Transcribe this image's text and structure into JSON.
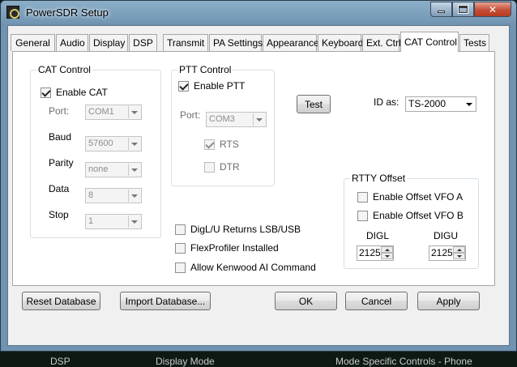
{
  "window": {
    "title": "PowerSDR Setup"
  },
  "caption": {
    "minimize": "",
    "maximize": "",
    "close": "✕"
  },
  "tabs": [
    {
      "label": "General"
    },
    {
      "label": "Audio"
    },
    {
      "label": "Display"
    },
    {
      "label": "DSP"
    },
    {
      "label": "Transmit"
    },
    {
      "label": "PA Settings"
    },
    {
      "label": "Appearance"
    },
    {
      "label": "Keyboard"
    },
    {
      "label": "Ext. Ctrl"
    },
    {
      "label": "CAT Control"
    },
    {
      "label": "Tests"
    }
  ],
  "active_tab": "CAT Control",
  "cat_control": {
    "title": "CAT Control",
    "enable": {
      "label": "Enable CAT",
      "checked": true
    },
    "port": {
      "label": "Port:",
      "value": "COM1"
    },
    "baud": {
      "label": "Baud",
      "value": "57600"
    },
    "parity": {
      "label": "Parity",
      "value": "none"
    },
    "data": {
      "label": "Data",
      "value": "8"
    },
    "stop": {
      "label": "Stop",
      "value": "1"
    }
  },
  "ptt_control": {
    "title": "PTT Control",
    "enable": {
      "label": "Enable PTT",
      "checked": true
    },
    "port": {
      "label": "Port:",
      "value": "COM3"
    },
    "rts": {
      "label": "RTS",
      "checked": true
    },
    "dtr": {
      "label": "DTR",
      "checked": false
    }
  },
  "test_button": "Test",
  "id_as": {
    "label": "ID as:",
    "value": "TS-2000"
  },
  "options": [
    {
      "label": "DigL/U Returns LSB/USB",
      "checked": false
    },
    {
      "label": "FlexProfiler Installed",
      "checked": false
    },
    {
      "label": "Allow Kenwood AI Command",
      "checked": false
    }
  ],
  "rtty_offset": {
    "title": "RTTY Offset",
    "vfo_a": {
      "label": "Enable Offset VFO A",
      "checked": false
    },
    "vfo_b": {
      "label": "Enable Offset VFO B",
      "checked": false
    },
    "digl": {
      "label": "DIGL",
      "value": "2125"
    },
    "digu": {
      "label": "DIGU",
      "value": "2125"
    }
  },
  "buttons": {
    "reset_db": "Reset Database",
    "import_db": "Import Database...",
    "ok": "OK",
    "cancel": "Cancel",
    "apply": "Apply"
  },
  "background_strip": [
    "DSP",
    "Display Mode",
    "Mode Specific Controls - Phone"
  ]
}
